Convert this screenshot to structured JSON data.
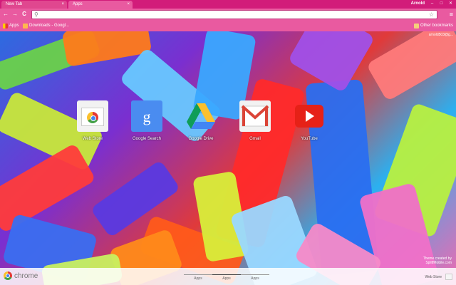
{
  "tabs": [
    {
      "label": "New Tab",
      "close": "×"
    },
    {
      "label": "Apps",
      "close": "×"
    }
  ],
  "profile_name": "Arnold",
  "window_controls": [
    "–",
    "□",
    "✕"
  ],
  "toolbar": {
    "back": "←",
    "forward": "→",
    "reload": "C",
    "omnibox_value": "",
    "star": "☆",
    "menu": "≡"
  },
  "bookmarks": [
    {
      "label": "Apps",
      "icon": "apps-grid-icon"
    },
    {
      "label": "Downloads - Googl...",
      "icon": "downloads-icon"
    }
  ],
  "other_bookmarks": "Other bookmarks",
  "account": "arnold503@g...",
  "apps": [
    {
      "label": "Web Store",
      "icon": "web-store-icon"
    },
    {
      "label": "Google Search",
      "icon": "google-search-icon"
    },
    {
      "label": "Google Drive",
      "icon": "google-drive-icon"
    },
    {
      "label": "Gmail",
      "icon": "gmail-icon"
    },
    {
      "label": "YouTube",
      "icon": "youtube-icon"
    }
  ],
  "footer": {
    "brand": "chrome",
    "pages": [
      "Apps",
      "Apps",
      "Apps"
    ],
    "current_page": 2,
    "webstore": "Web Store"
  },
  "credit": [
    "Theme created by",
    "SplitfMobile.com"
  ],
  "colors": {
    "frame": "#d21c7a",
    "toolbar": "#e95aa0"
  }
}
